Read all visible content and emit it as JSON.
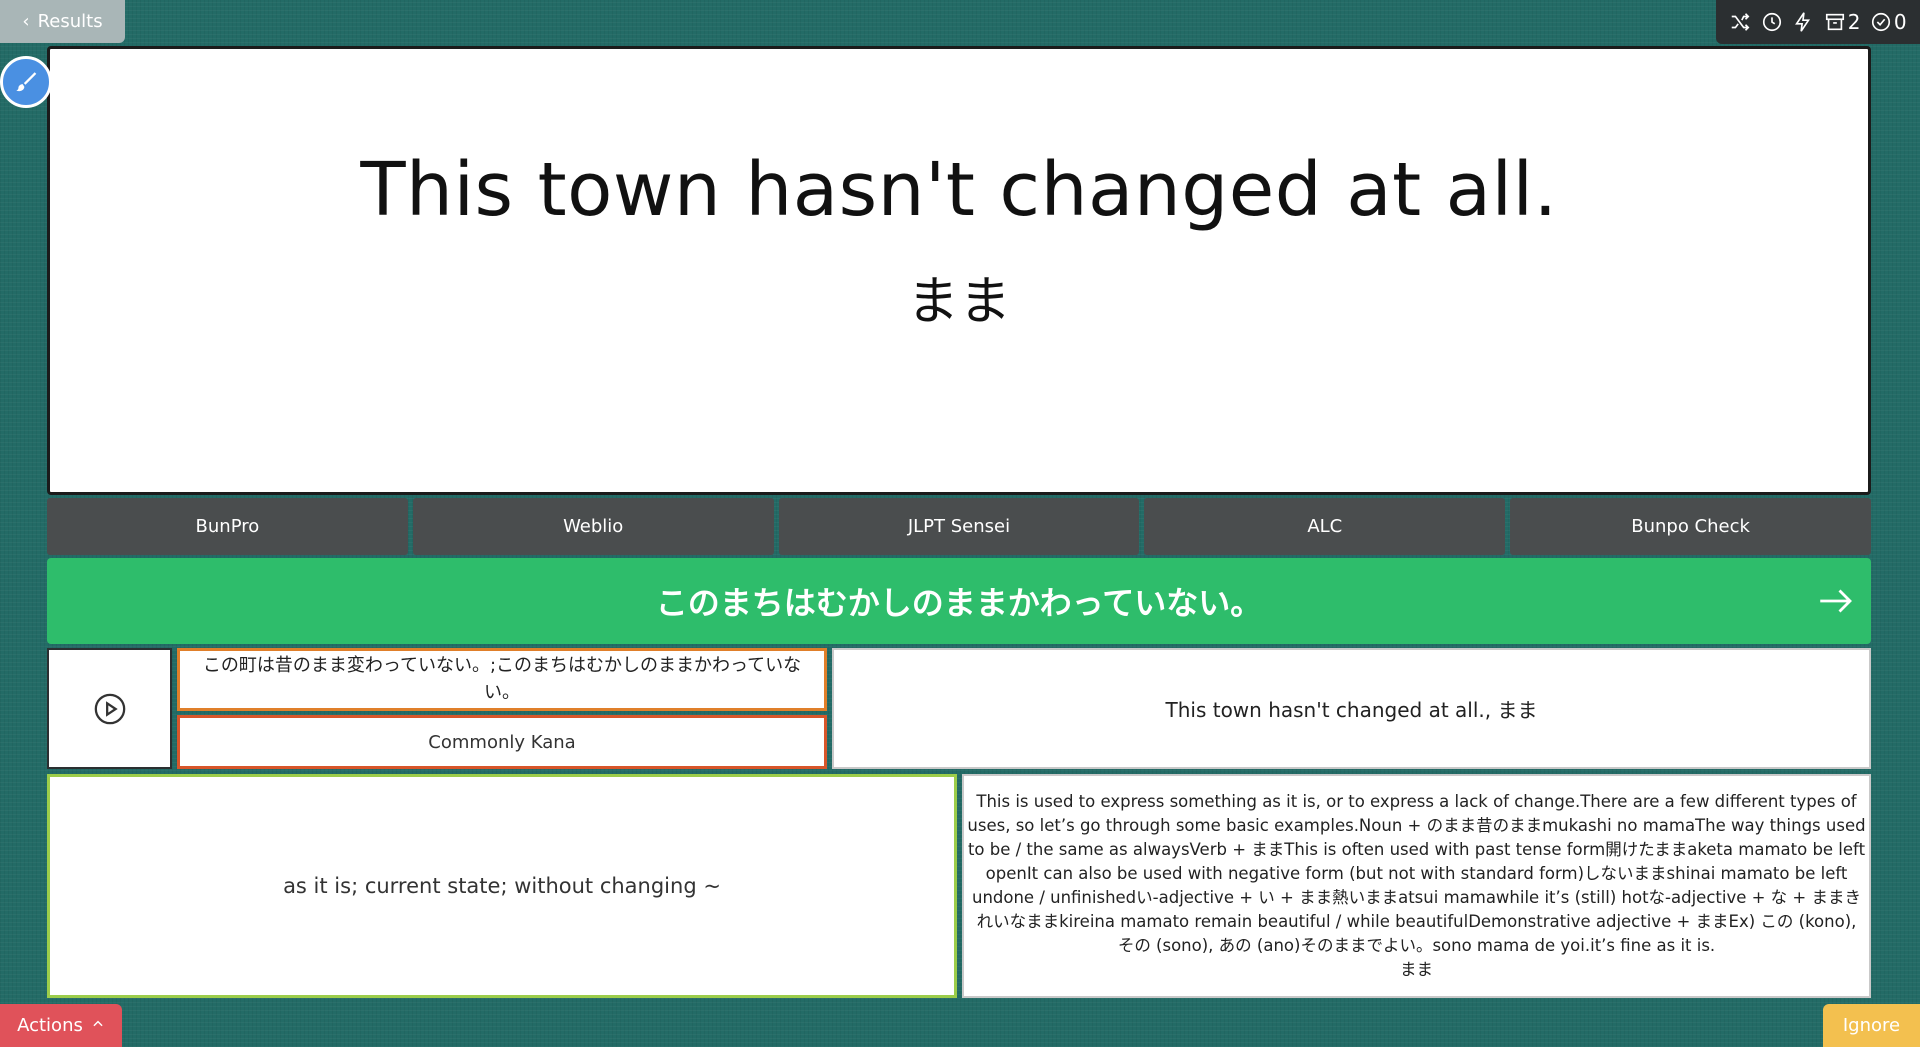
{
  "nav": {
    "results_label": "Results"
  },
  "toolbar": {
    "icons": [
      "shuffle-icon",
      "clock-icon",
      "lightning-icon",
      "archive-icon",
      "check-circle-icon"
    ],
    "archive_count": "2",
    "check_count": "0"
  },
  "card": {
    "sentence": "This town hasn't changed at all.",
    "grammar": "まま"
  },
  "links": [
    {
      "label": "BunPro"
    },
    {
      "label": "Weblio"
    },
    {
      "label": "JLPT Sensei"
    },
    {
      "label": "ALC"
    },
    {
      "label": "Bunpo Check"
    }
  ],
  "answer": {
    "text": "このまちはむかしのままかわっていない。"
  },
  "details": {
    "jp_sentence": "この町は昔のまま変わっていない。;このまちはむかしのままかわっていない。",
    "kana_label": "Commonly Kana",
    "en_sentence": "This town hasn't changed at all., まま",
    "meaning": "as it is; current state; without changing ~",
    "explanation": "This is used to express something as it is, or to express a lack of change.There are a few different types of uses, so let’s go through some basic examples.Noun + のまま昔のままmukashi no mamaThe way things used to be / the same as alwaysVerb + ままThis is often used with past tense form開けたままaketa mamato be left openIt can also be used with negative form (but not with standard form)しないままshinai mamato be left undone / unfinishedい-adjective + い + まま熱いままatsui mamawhile it’s (still) hotな-adjective + な + ままきれいなままkireina mamato remain beautiful / while beautifulDemonstrative adjective + ままEx) この (kono), その (sono), あの (ano)そのままでよい。sono mama de yoi.it’s fine as it is.\nまま"
  },
  "bottom": {
    "actions_label": "Actions",
    "ignore_label": "Ignore"
  },
  "colors": {
    "background": "#236b66",
    "answer_bar": "#2ebd6b",
    "link_button": "#4a4d4e",
    "actions_button": "#e0525a",
    "ignore_button": "#f3c04f",
    "brush_button": "#4a90e2"
  }
}
